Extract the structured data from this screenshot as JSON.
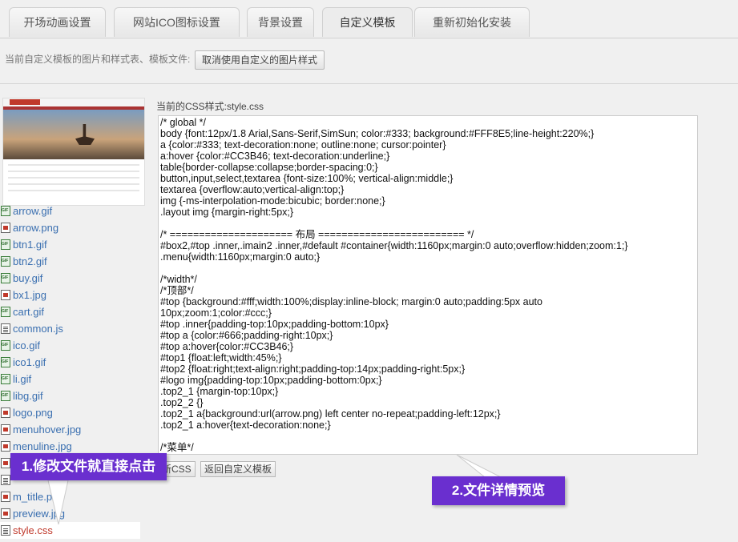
{
  "tabs": [
    {
      "label": "开场动画设置",
      "active": false
    },
    {
      "label": "网站ICO图标设置",
      "active": false
    },
    {
      "label": "背景设置",
      "active": false
    },
    {
      "label": "自定义模板",
      "active": true
    },
    {
      "label": "重新初始化安装",
      "active": false
    }
  ],
  "toolbar": {
    "label": "当前自定义模板的图片和样式表、模板文件:",
    "cancel_button": "取消使用自定义的图片样式"
  },
  "files": [
    {
      "name": "arrow.gif",
      "icon": "gif-icon"
    },
    {
      "name": "arrow.png",
      "icon": "image-icon"
    },
    {
      "name": "btn1.gif",
      "icon": "gif-icon"
    },
    {
      "name": "btn2.gif",
      "icon": "gif-icon"
    },
    {
      "name": "buy.gif",
      "icon": "gif-icon"
    },
    {
      "name": "bx1.jpg",
      "icon": "image-icon"
    },
    {
      "name": "cart.gif",
      "icon": "gif-icon"
    },
    {
      "name": "common.js",
      "icon": "document-icon"
    },
    {
      "name": "ico.gif",
      "icon": "gif-icon"
    },
    {
      "name": "ico1.gif",
      "icon": "gif-icon"
    },
    {
      "name": "li.gif",
      "icon": "gif-icon"
    },
    {
      "name": "libg.gif",
      "icon": "gif-icon"
    },
    {
      "name": "logo.png",
      "icon": "image-icon"
    },
    {
      "name": "menuhover.jpg",
      "icon": "image-icon"
    },
    {
      "name": "menuline.jpg",
      "icon": "image-icon"
    },
    {
      "name": "",
      "icon": "image-icon"
    },
    {
      "name": "",
      "icon": "document-icon"
    },
    {
      "name": "m_title.png",
      "icon": "image-icon"
    },
    {
      "name": "preview.jpg",
      "icon": "image-icon"
    },
    {
      "name": "style.css",
      "icon": "document-icon",
      "selected": true
    }
  ],
  "editor": {
    "title": "当前的CSS样式:style.css",
    "lines": [
      "/* global */",
      "body {font:12px/1.8 Arial,Sans-Serif,SimSun; color:#333; background:#FFF8E5;line-height:220%;}",
      "a {color:#333; text-decoration:none; outline:none; cursor:pointer}",
      "a:hover {color:#CC3B46; text-decoration:underline;}",
      "table{border-collapse:collapse;border-spacing:0;}",
      "button,input,select,textarea {font-size:100%; vertical-align:middle;}",
      "textarea {overflow:auto;vertical-align:top;}",
      "img {-ms-interpolation-mode:bicubic; border:none;}",
      ".layout img {margin-right:5px;}",
      "",
      "/* ===================== 布局 ========================= */",
      "#box2,#top .inner,.imain2 .inner,#default #container{width:1160px;margin:0 auto;overflow:hidden;zoom:1;}",
      ".menu{width:1160px;margin:0 auto;}",
      "",
      "/*width*/",
      "/*顶部*/",
      "#top {background:#fff;width:100%;display:inline-block; margin:0 auto;padding:5px auto",
      "10px;zoom:1;color:#ccc;}",
      "#top .inner{padding-top:10px;padding-bottom:10px}",
      "#top a {color:#666;padding-right:10px;}",
      "#top a:hover{color:#CC3B46;}",
      "#top1 {float:left;width:45%;}",
      "#top2 {float:right;text-align:right;padding-top:14px;padding-right:5px;}",
      "#logo img{padding-top:10px;padding-bottom:0px;}",
      ".top2_1 {margin-top:10px;}",
      ".top2_2 {}",
      ".top2_1 a{background:url(arrow.png) left center no-repeat;padding-left:12px;}",
      ".top2_1 a:hover{text-decoration:none;}",
      "",
      "/*菜单*/"
    ]
  },
  "actions": {
    "save_partial": "新CSS",
    "back": "返回自定义模板"
  },
  "callouts": {
    "one": "1.修改文件就直接点击",
    "two": "2.文件详情预览"
  },
  "colors": {
    "callout": "#6a2fcf",
    "link": "#3a6fb0",
    "selected": "#c0392b"
  }
}
